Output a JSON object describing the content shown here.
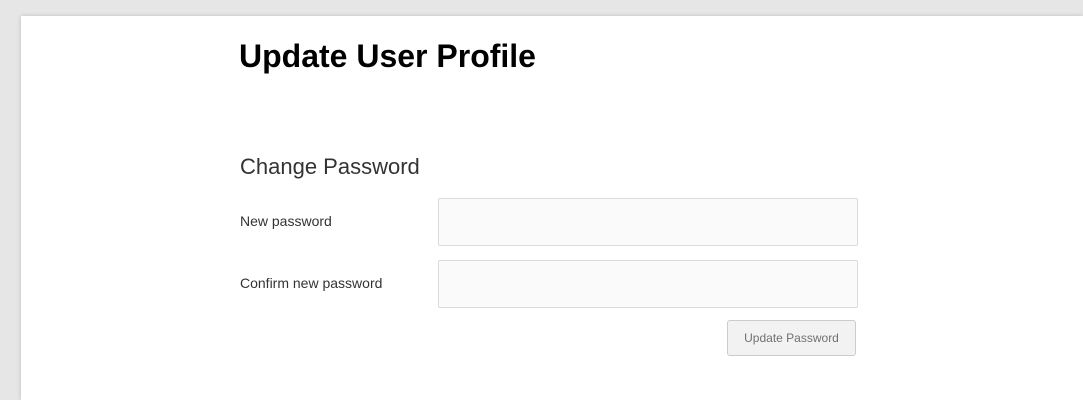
{
  "page": {
    "title": "Update User Profile"
  },
  "password_section": {
    "title": "Change Password",
    "new_password": {
      "label": "New password",
      "value": "",
      "placeholder": ""
    },
    "confirm_password": {
      "label": "Confirm new password",
      "value": "",
      "placeholder": ""
    },
    "submit_label": "Update Password"
  },
  "colors": {
    "background": "#e6e6e6",
    "panel": "#ffffff",
    "title_text": "#000000",
    "body_text": "#333333",
    "input_border": "#dcdcdc",
    "button_background": "#f2f2f2",
    "button_text": "#707070"
  }
}
